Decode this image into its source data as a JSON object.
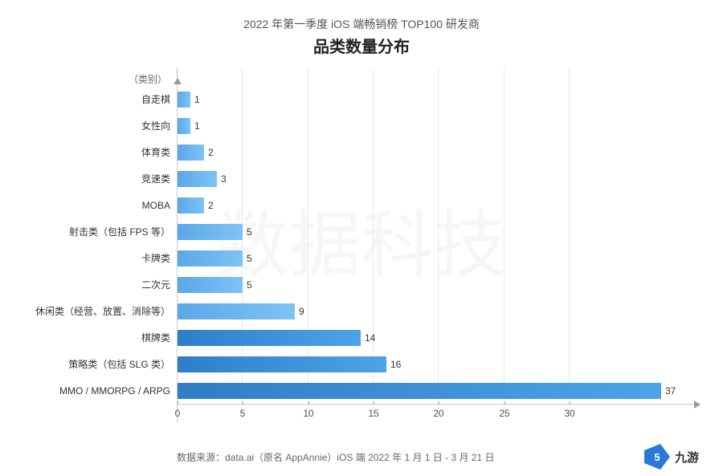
{
  "title": {
    "sub": "2022 年第一季度 iOS 端畅销榜 TOP100 研发商",
    "main": "品类数量分布"
  },
  "yAxisTopLabel": "（类别）",
  "categories": [
    {
      "label": "自走棋",
      "value": 1
    },
    {
      "label": "女性向",
      "value": 1
    },
    {
      "label": "体育类",
      "value": 2
    },
    {
      "label": "竞速类",
      "value": 3
    },
    {
      "label": "MOBA",
      "value": 2
    },
    {
      "label": "射击类（包括 FPS 等）",
      "value": 5
    },
    {
      "label": "卡牌类",
      "value": 5
    },
    {
      "label": "二次元",
      "value": 5
    },
    {
      "label": "休闲类（经营、放置、消除等）",
      "value": 9
    },
    {
      "label": "棋牌类",
      "value": 14
    },
    {
      "label": "策略类（包括 SLG 类）",
      "value": 16
    },
    {
      "label": "MMO / MMORPG / ARPG",
      "value": 37
    }
  ],
  "xAxis": {
    "ticks": [
      0,
      5,
      10,
      15,
      20,
      25,
      30
    ],
    "maxValue": 37,
    "maxDisplay": 35
  },
  "footer": {
    "source": "数据来源：data.ai（原名 AppAnnie）iOS 端 2022 年 1 月 1 日 - 3 月 21 日",
    "logoText": "九游"
  },
  "colors": {
    "barNormal": "#5ba8e8",
    "barDark": "#2e7ec7"
  }
}
